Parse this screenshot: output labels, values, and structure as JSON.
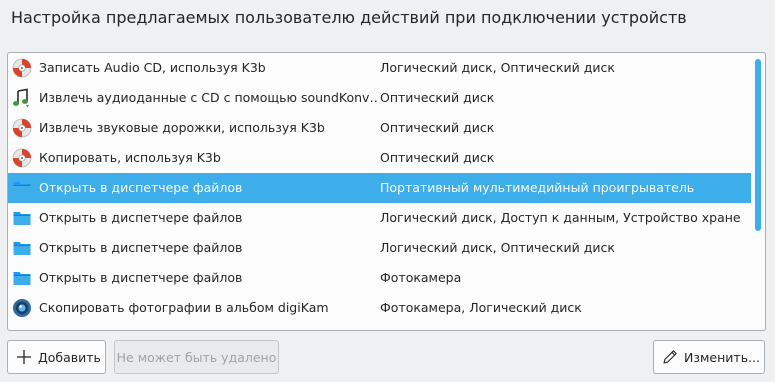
{
  "dialog": {
    "title": "Настройка предлагаемых пользователю действий при подключении устройств"
  },
  "actions": [
    {
      "name": "Записать Audio CD, используя K3b",
      "devices": "Логический диск, Оптический диск",
      "icon": "k3b-icon",
      "selected": false
    },
    {
      "name": "Извлечь аудиоданные с CD с помощью soundKonv…",
      "devices": "Оптический диск",
      "icon": "soundkonverter-icon",
      "selected": false
    },
    {
      "name": "Извлечь звуковые дорожки, используя K3b",
      "devices": "Оптический диск",
      "icon": "k3b-icon",
      "selected": false
    },
    {
      "name": "Копировать, используя K3b",
      "devices": "Оптический диск",
      "icon": "k3b-icon",
      "selected": false
    },
    {
      "name": "Открыть в диспетчере файлов",
      "devices": "Портативный мультимедийный проигрыватель",
      "icon": "folder-icon",
      "selected": true
    },
    {
      "name": "Открыть в диспетчере файлов",
      "devices": "Логический диск, Доступ к данным, Устройство хране…",
      "icon": "folder-icon",
      "selected": false
    },
    {
      "name": "Открыть в диспетчере файлов",
      "devices": "Логический диск, Оптический диск",
      "icon": "folder-icon",
      "selected": false
    },
    {
      "name": "Открыть в диспетчере файлов",
      "devices": "Фотокамера",
      "icon": "folder-icon",
      "selected": false
    },
    {
      "name": "Скопировать фотографии в альбом digiKam",
      "devices": "Фотокамера, Логический диск",
      "icon": "digikam-icon",
      "selected": false
    }
  ],
  "buttons": {
    "add_label": "Добавить",
    "add_icon": "plus-icon",
    "remove_label": "Не может быть удалено",
    "edit_label": "Изменить...",
    "edit_icon": "pencil-icon"
  },
  "colors": {
    "selection": "#3daee9",
    "window_bg": "#eff0f1",
    "list_bg": "#fcfcfc"
  }
}
